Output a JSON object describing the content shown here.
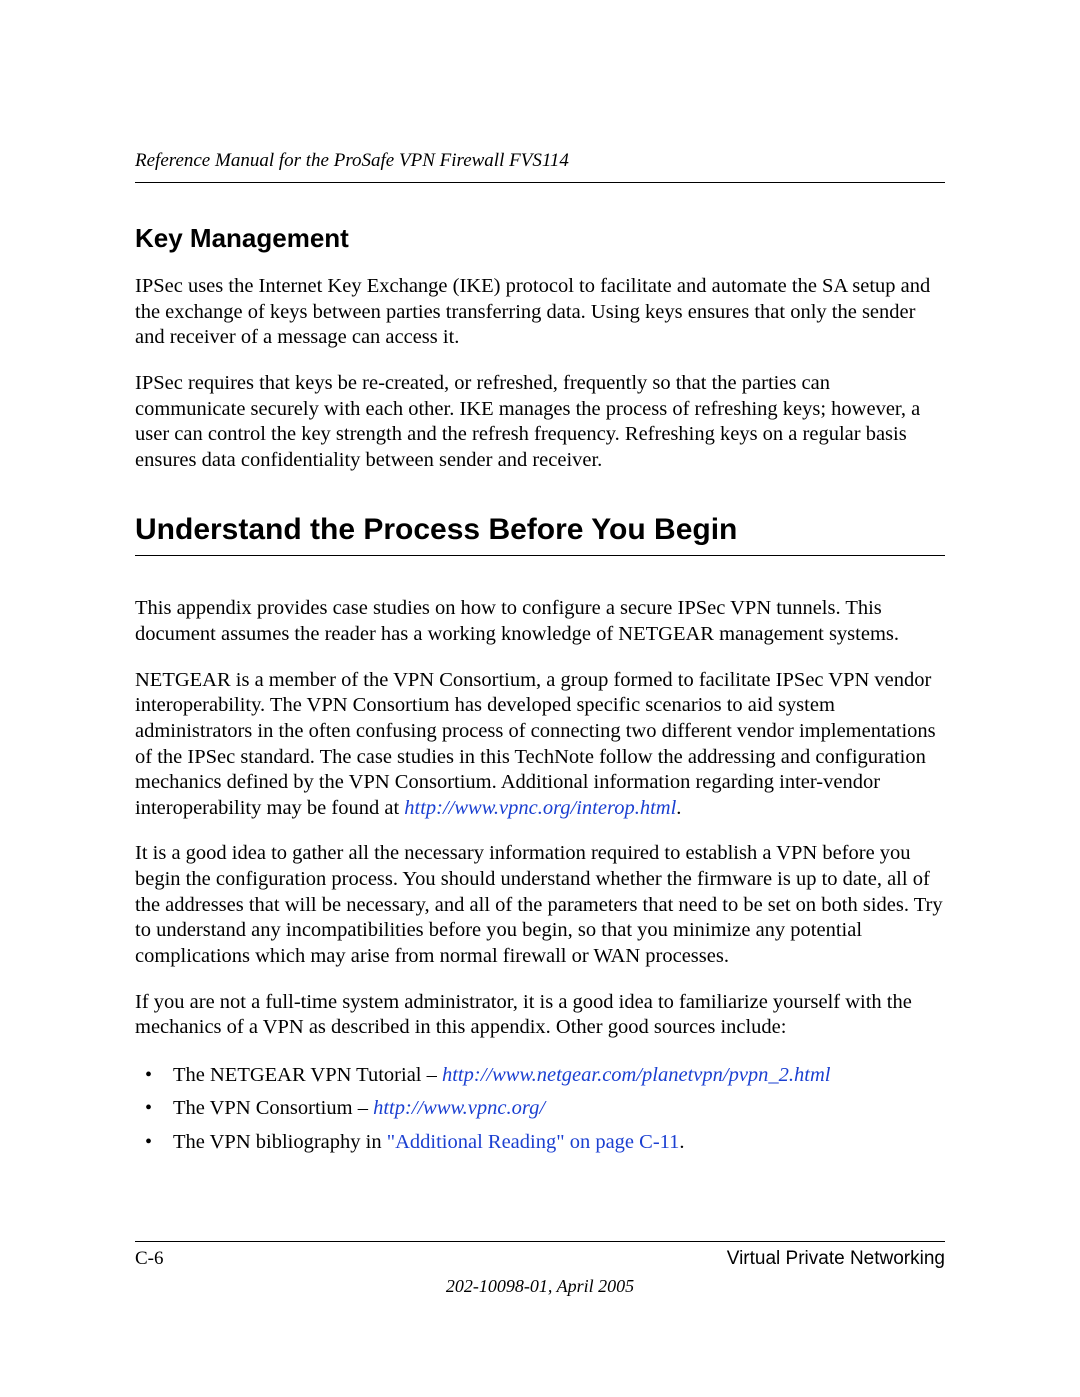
{
  "header": {
    "running_title": "Reference Manual for the ProSafe VPN Firewall FVS114"
  },
  "sections": {
    "key_mgmt": {
      "heading": "Key Management",
      "p1": "IPSec uses the Internet Key Exchange (IKE) protocol to facilitate and automate the SA setup and the exchange of keys between parties transferring data. Using keys ensures that only the sender and receiver of a message can access it.",
      "p2": "IPSec requires that keys be re-created, or refreshed, frequently so that the parties can communicate securely with each other. IKE manages the process of refreshing keys; however, a user can control the key strength and the refresh frequency. Refreshing keys on a regular basis ensures data confidentiality between sender and receiver."
    },
    "understand": {
      "heading": "Understand the Process Before You Begin",
      "p1": "This appendix provides case studies on how to configure a secure IPSec VPN tunnels. This document assumes the reader has a working knowledge of NETGEAR management systems.",
      "p2_pre": "NETGEAR is a member of the VPN Consortium, a group formed to facilitate IPSec VPN vendor interoperability. The VPN Consortium has developed specific scenarios to aid system administrators in the often confusing process of connecting two different vendor implementations of the IPSec standard. The case studies in this TechNote follow the addressing and configuration mechanics defined by the VPN Consortium. Additional information regarding inter-vendor interoperability may be found at ",
      "p2_link": "http://www.vpnc.org/interop.html",
      "p2_post": ".",
      "p3": "It is a good idea to gather all the necessary information required to establish a VPN before you begin the configuration process. You should understand whether the firmware is up to date, all of the addresses that will be necessary, and all of the parameters that need to be set on both sides. Try to understand any incompatibilities before you begin, so that you minimize any potential complications which may arise from normal firewall or WAN processes.",
      "p4": "If you are not a full-time system administrator, it is a good idea to familiarize yourself with the mechanics of a VPN as described in this appendix. Other good sources include:",
      "bullets": {
        "b1_pre": "The NETGEAR VPN Tutorial – ",
        "b1_link": "http://www.netgear.com/planetvpn/pvpn_2.html",
        "b2_pre": "The VPN Consortium – ",
        "b2_link": "http://www.vpnc.org/",
        "b3_pre": "The VPN bibliography in ",
        "b3_xref": "\"Additional Reading\" on page C-11",
        "b3_post": "."
      }
    }
  },
  "footer": {
    "page_number": "C-6",
    "section": "Virtual Private Networking",
    "docinfo": "202-10098-01, April 2005"
  }
}
